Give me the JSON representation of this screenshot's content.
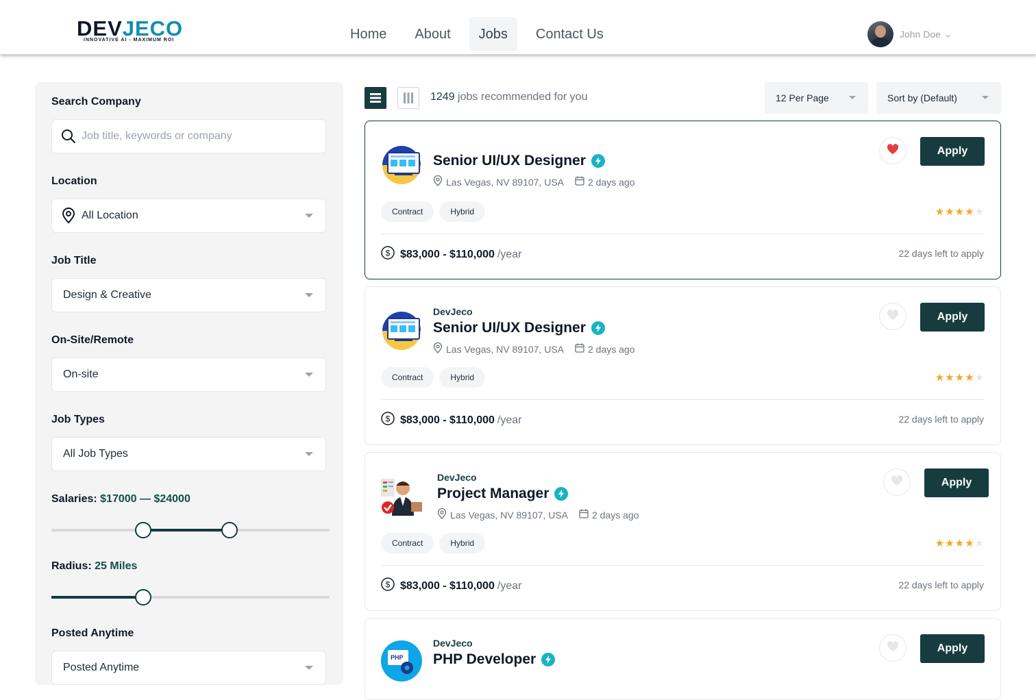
{
  "brand": {
    "name_part1": "DEV",
    "name_part2": "JECO",
    "tagline": "INNOVATIVE AI - MAXIMUM ROI"
  },
  "nav": {
    "items": [
      {
        "label": "Home"
      },
      {
        "label": "About"
      },
      {
        "label": "Jobs",
        "active": true
      },
      {
        "label": "Contact Us"
      }
    ]
  },
  "user": {
    "name": "John Doe"
  },
  "filters": {
    "search": {
      "label": "Search Company",
      "placeholder": "Job title, keywords or company"
    },
    "location": {
      "label": "Location",
      "value": "All Location"
    },
    "job_title": {
      "label": "Job Title",
      "value": "Design & Creative"
    },
    "onsite": {
      "label": "On-Site/Remote",
      "value": "On-site"
    },
    "job_types": {
      "label": "Job Types",
      "value": "All Job Types"
    },
    "salary": {
      "label": "Salaries:",
      "value": "$17000 — $24000",
      "min_fraction": 0.33,
      "max_fraction": 0.64
    },
    "radius": {
      "label": "Radius:",
      "value": "25 Miles",
      "fraction": 0.33
    },
    "posted": {
      "label": "Posted Anytime",
      "value": "Posted Anytime"
    }
  },
  "toolbar": {
    "count": "1249",
    "count_text": " jobs recommended for you",
    "per_page": "12 Per Page",
    "sort": "Sort by (Default)"
  },
  "jobs": [
    {
      "company": "",
      "title": "Senior UI/UX Designer",
      "location": "Las Vegas, NV 89107, USA",
      "posted": "2 days ago",
      "tags": [
        "Contract",
        "Hybrid"
      ],
      "rating": 4,
      "salary": "$83,000 - $110,000",
      "period": "/year",
      "deadline": "22 days left to apply",
      "apply": "Apply",
      "saved": true,
      "logo": "designer-icon"
    },
    {
      "company": "DevJeco",
      "title": "Senior UI/UX Designer",
      "location": "Las Vegas, NV 89107, USA",
      "posted": "2 days ago",
      "tags": [
        "Contract",
        "Hybrid"
      ],
      "rating": 4,
      "salary": "$83,000 - $110,000",
      "period": "/year",
      "deadline": "22 days left to apply",
      "apply": "Apply",
      "saved": false,
      "logo": "designer-icon"
    },
    {
      "company": "DevJeco",
      "title": "Project Manager",
      "location": "Las Vegas, NV 89107, USA",
      "posted": "2 days ago",
      "tags": [
        "Contract",
        "Hybrid"
      ],
      "rating": 4,
      "salary": "$83,000 - $110,000",
      "period": "/year",
      "deadline": "22 days left to apply",
      "apply": "Apply",
      "saved": false,
      "logo": "manager-icon"
    },
    {
      "company": "DevJeco",
      "title": "PHP Developer",
      "apply": "Apply",
      "saved": false,
      "logo": "php-icon",
      "logo_text": "PHP"
    }
  ],
  "colors": {
    "primary": "#163c40",
    "verified": "#19b3c4",
    "star": "#f5a623",
    "heart": "#e53e3e"
  }
}
